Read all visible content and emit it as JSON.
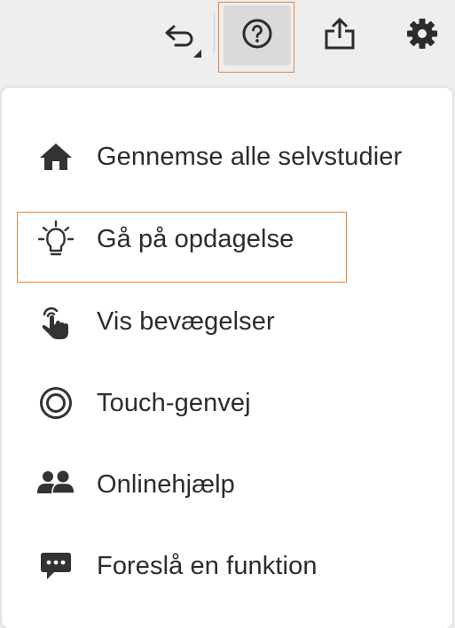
{
  "toolbar": {
    "undo_icon": "undo-icon",
    "help_icon": "help-circle-icon",
    "share_icon": "share-icon",
    "settings_icon": "gear-icon",
    "highlight_color": "#e8873a"
  },
  "menu": {
    "items": [
      {
        "label": "Gennemse alle selvstudier",
        "icon": "home-icon"
      },
      {
        "label": "Gå på opdagelse",
        "icon": "lightbulb-icon"
      },
      {
        "label": "Vis bevægelser",
        "icon": "touch-gesture-icon"
      },
      {
        "label": "Touch-genvej",
        "icon": "touch-shortcut-icon"
      },
      {
        "label": "Onlinehjælp",
        "icon": "community-icon"
      },
      {
        "label": "Foreslå en funktion",
        "icon": "chat-bubble-icon"
      }
    ]
  }
}
